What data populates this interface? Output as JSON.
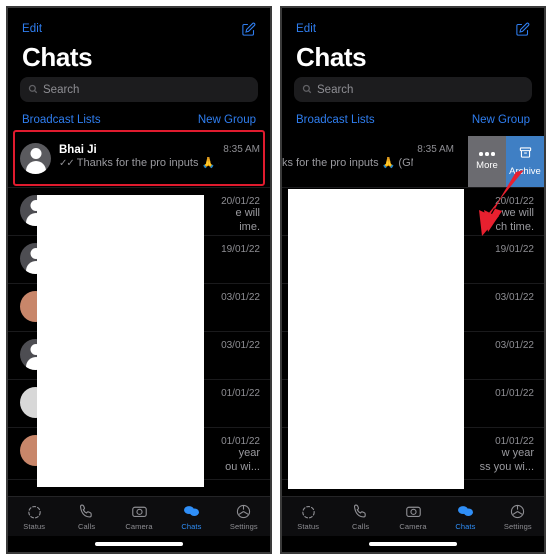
{
  "panels": [
    {
      "id": "left",
      "nav": {
        "edit": "Edit",
        "compose_icon": "compose-icon"
      },
      "title": "Chats",
      "search": {
        "placeholder": "Search",
        "icon": "search-icon"
      },
      "broadcast": {
        "left": "Broadcast Lists",
        "right": "New Group"
      },
      "highlighted_chat": {
        "name": "Bhai Ji",
        "time": "8:35 AM",
        "ticks": "✓✓",
        "preview": "Thanks for the pro inputs 🙏 (GM)"
      },
      "chats": [
        {
          "name": "",
          "time": "20/01/22",
          "preview_lines": [
            "e will",
            "ime."
          ]
        },
        {
          "name": "",
          "time": "19/01/22",
          "preview_lines": []
        },
        {
          "name": "",
          "time": "03/01/22",
          "preview_lines": []
        },
        {
          "name": "",
          "time": "03/01/22",
          "preview_lines": []
        },
        {
          "name": "",
          "time": "01/01/22",
          "preview_lines": []
        },
        {
          "name": "",
          "time": "01/01/22",
          "preview_lines": [
            "year",
            "ou wi..."
          ]
        }
      ],
      "swipe_visible": false
    },
    {
      "id": "right",
      "nav": {
        "edit": "Edit",
        "compose_icon": "compose-icon"
      },
      "title": "Chats",
      "search": {
        "placeholder": "Search",
        "icon": "search-icon"
      },
      "broadcast": {
        "left": "Broadcast Lists",
        "right": "New Group"
      },
      "highlighted_chat": {
        "name": "",
        "time": "8:35 AM",
        "ticks": "",
        "preview": "ks for the pro inputs 🙏 (GM)"
      },
      "chats": [
        {
          "name": "",
          "time": "20/01/22",
          "preview_lines": [
            "we will",
            "ch time."
          ]
        },
        {
          "name": "",
          "time": "19/01/22",
          "preview_lines": []
        },
        {
          "name": "",
          "time": "03/01/22",
          "preview_lines": []
        },
        {
          "name": "",
          "time": "03/01/22",
          "preview_lines": []
        },
        {
          "name": "",
          "time": "01/01/22",
          "preview_lines": []
        },
        {
          "name": "",
          "time": "01/01/22",
          "preview_lines": [
            "w year",
            "ss you wi..."
          ]
        }
      ],
      "swipe_visible": true,
      "swipe_actions": [
        {
          "label": "More",
          "icon": "ellipsis-icon",
          "color": "#6b6b70"
        },
        {
          "label": "Archive",
          "icon": "archive-box-icon",
          "color": "#3f7fc4"
        }
      ],
      "annotation": {
        "type": "arrow",
        "color": "#e8202f",
        "points_to": "Archive"
      }
    }
  ],
  "tabbar": {
    "items": [
      {
        "label": "Status",
        "icon": "status-ring-icon",
        "active": false
      },
      {
        "label": "Calls",
        "icon": "phone-icon",
        "active": false
      },
      {
        "label": "Camera",
        "icon": "camera-icon",
        "active": false
      },
      {
        "label": "Chats",
        "icon": "chat-bubbles-icon",
        "active": true
      },
      {
        "label": "Settings",
        "icon": "gear-icon",
        "active": false
      }
    ]
  },
  "colors": {
    "accent_blue": "#2f7ef0",
    "tab_active": "#2f8ef7",
    "archive_blue": "#3f7fc4",
    "more_gray": "#6b6b70",
    "highlight_red": "#e01b2e",
    "arrow_red": "#e8202f",
    "background": "#000000",
    "search_bg": "#1c1c1e",
    "secondary_text": "#8e8e93"
  }
}
